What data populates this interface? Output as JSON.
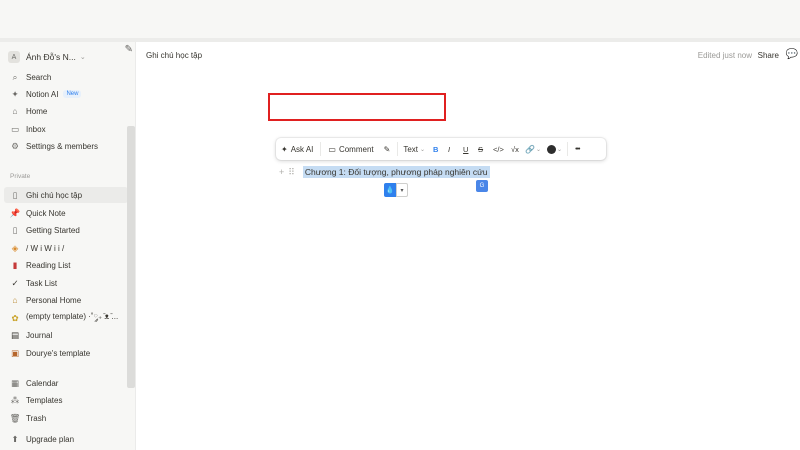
{
  "workspace": {
    "avatar": "A",
    "name": "Ánh Đỗ's N..."
  },
  "sidebar": {
    "top_items": [
      {
        "label": "Search",
        "icon": "search-icon"
      },
      {
        "label": "Notion AI",
        "icon": "sparkle-icon",
        "badge": "New"
      },
      {
        "label": "Home",
        "icon": "home-icon"
      },
      {
        "label": "Inbox",
        "icon": "inbox-icon"
      },
      {
        "label": "Settings & members",
        "icon": "gear-icon"
      }
    ],
    "private_label": "Private",
    "pages": [
      {
        "label": "Ghi chú học tập",
        "icon": "page-icon"
      },
      {
        "label": "Quick Note",
        "icon": "pin-icon"
      },
      {
        "label": "Getting Started",
        "icon": "page-icon"
      },
      {
        "label": "/ W i W i i /",
        "icon": "emoji-icon"
      },
      {
        "label": "Reading List",
        "icon": "book-icon"
      },
      {
        "label": "Task List",
        "icon": "check-icon"
      },
      {
        "label": "Personal Home",
        "icon": "house-icon"
      },
      {
        "label": "(empty template) ·˚༘₊ ̄ᴥ ̄...",
        "icon": "emoji-icon"
      },
      {
        "label": "Journal",
        "icon": "journal-icon"
      },
      {
        "label": "Dourye's template",
        "icon": "template-icon"
      }
    ],
    "bottom_items": [
      {
        "label": "Calendar",
        "icon": "calendar-icon"
      },
      {
        "label": "Templates",
        "icon": "templates-icon"
      },
      {
        "label": "Trash",
        "icon": "trash-icon"
      }
    ],
    "upgrade": "Upgrade plan"
  },
  "header": {
    "breadcrumb": "Ghi chú học tập",
    "edited": "Edited just now",
    "share": "Share"
  },
  "toolbar": {
    "ask_ai": "Ask AI",
    "comment": "Comment",
    "text_type": "Text",
    "bold": "B",
    "italic": "I",
    "underline": "U",
    "strike": "S",
    "code": "</>",
    "math": "√x",
    "more": "•••"
  },
  "block": {
    "text": "Chương 1: Đối tượng, phương pháp nghiên cứu"
  },
  "colors": {
    "accent": "#2f80ed",
    "highlight_box": "#e02020",
    "selection": "#c5dcf3"
  }
}
